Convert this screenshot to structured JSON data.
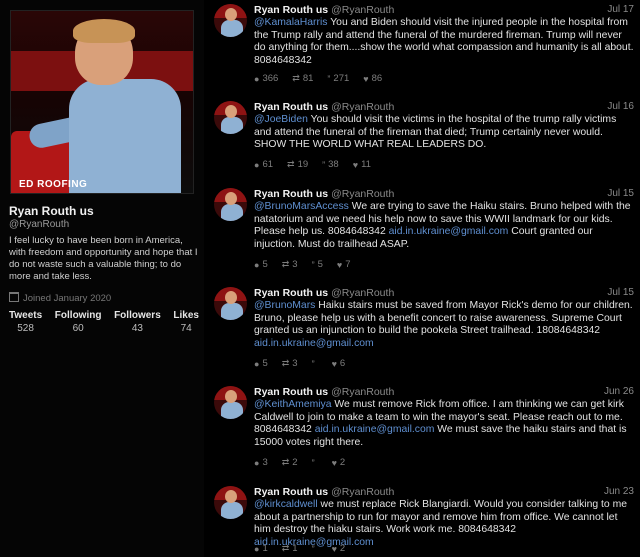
{
  "profile": {
    "name": "Ryan Routh us",
    "handle": "@RyanRouth",
    "photo_banner": "ED ROOFING",
    "bio": "I feel lucky to have been born in America, with freedom and opportunity and hope that I do not waste such a valuable thing; to do more and take less.",
    "joined": "Joined January 2020",
    "stats": [
      {
        "label": "Tweets",
        "value": "528"
      },
      {
        "label": "Following",
        "value": "60"
      },
      {
        "label": "Followers",
        "value": "43"
      },
      {
        "label": "Likes",
        "value": "74"
      }
    ]
  },
  "icons": {
    "reply": "speech-bubble-icon",
    "retweet": "retweet-arrows-icon",
    "quote": "quote-icon",
    "like": "heart-icon",
    "joined": "calendar-icon"
  },
  "colors": {
    "background": "#000000",
    "link": "#5f8fd0",
    "text": "#e2e2e2",
    "muted": "#8a8a8a"
  },
  "tweets": [
    {
      "name": "Ryan Routh us",
      "handle": "@RyanRouth",
      "date": "Jul 17",
      "mention": "@KamalaHarris",
      "text": " You and Biden should visit the injured people in the hospital from the Trump rally and attend the funeral of the murdered fireman. Trump will never do anything for them....show the world what compassion and humanity is all about. 8084648342",
      "email": "",
      "text_after": "",
      "replies": "366",
      "retweets": "81",
      "quotes": "271",
      "likes": "86"
    },
    {
      "name": "Ryan Routh us",
      "handle": "@RyanRouth",
      "date": "Jul 16",
      "mention": "@JoeBiden",
      "text": " You should visit the victims in the hospital of the trump rally victims and attend the funeral of the fireman that died; Trump certainly never would. SHOW THE WORLD WHAT REAL LEADERS DO.",
      "email": "",
      "text_after": "",
      "replies": "61",
      "retweets": "19",
      "quotes": "38",
      "likes": "11"
    },
    {
      "name": "Ryan Routh us",
      "handle": "@RyanRouth",
      "date": "Jul 15",
      "mention": "@BrunoMarsAccess",
      "text": " We are trying to save the Haiku stairs. Bruno helped with the natatorium and we need his help now to save this WWII landmark for our kids. Please help us. 8084648342 ",
      "email": "aid.in.ukraine@gmail.com",
      "text_after": " Court granted our injuction. Must do trailhead ASAP.",
      "replies": "5",
      "retweets": "3",
      "quotes": "5",
      "likes": "7"
    },
    {
      "name": "Ryan Routh us",
      "handle": "@RyanRouth",
      "date": "Jul 15",
      "mention": "@BrunoMars",
      "text": " Haiku stairs must be saved from Mayor Rick's demo for our children. Bruno, please help us with a benefit concert to raise awareness. Supreme Court granted us an injunction to build the pookela Street trailhead. 18084648342 ",
      "email": "aid.in.ukraine@gmail.com",
      "text_after": "",
      "replies": "5",
      "retweets": "3",
      "quotes": "",
      "likes": "6"
    },
    {
      "name": "Ryan Routh us",
      "handle": "@RyanRouth",
      "date": "Jun 26",
      "mention": "@KeithAmemiya",
      "text": " We must remove Rick from office. I am thinking we can get kirk Caldwell to join to make a team to win the mayor's seat. Please reach out to me. 8084648342 ",
      "email": "aid.in.ukraine@gmail.com",
      "text_after": " We must save the haiku stairs and that is 15000 votes right there.",
      "replies": "3",
      "retweets": "2",
      "quotes": "",
      "likes": "2"
    },
    {
      "name": "Ryan Routh us",
      "handle": "@RyanRouth",
      "date": "Jun 23",
      "mention": "@kirkcaldwell",
      "text": " we must replace Rick Blangiardi. Would you consider talking to me about a partnership to run for mayor and remove him from office. We cannot let him destroy the hiaku stairs. Work work me. 8084648342 ",
      "email": "aid.in.ukraine@gmail.com",
      "text_after": "",
      "replies": "1",
      "retweets": "1",
      "quotes": "",
      "likes": "2"
    }
  ]
}
